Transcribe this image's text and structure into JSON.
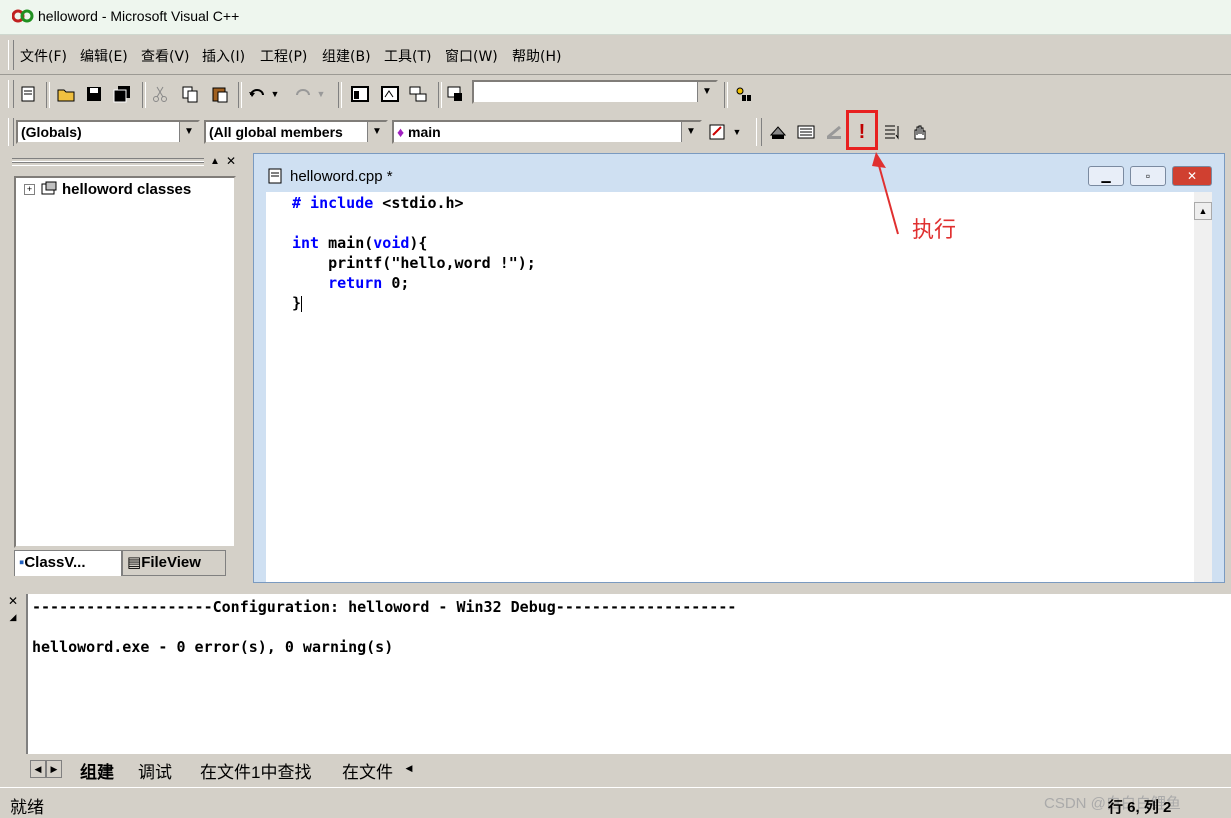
{
  "window": {
    "title": "helloword - Microsoft Visual C++"
  },
  "menubar": {
    "items": [
      "文件(F)",
      "编辑(E)",
      "查看(V)",
      "插入(I)",
      "工程(P)",
      "组建(B)",
      "工具(T)",
      "窗口(W)",
      "帮助(H)"
    ]
  },
  "toolbar2": {
    "globals": "(Globals)",
    "members": "(All global members",
    "function": "main",
    "function_marker": "♦"
  },
  "workspace": {
    "root": "helloword classes",
    "tabs": [
      "ClassV...",
      "FileView"
    ]
  },
  "editor": {
    "filename": "helloword.cpp *",
    "lines": [
      {
        "kw": "# include",
        "rest": " <stdio.h>"
      },
      {
        "kw": "",
        "rest": ""
      },
      {
        "kw": "int",
        "rest": " main(",
        "kw2": "void",
        "rest2": "){"
      },
      {
        "kw": "",
        "rest": "    printf(\"hello,word !\");"
      },
      {
        "kw": "    return",
        "rest": " 0;"
      },
      {
        "kw": "",
        "rest": "}"
      }
    ]
  },
  "output": {
    "line1": "--------------------Configuration: helloword - Win32 Debug--------------------",
    "line2": "helloword.exe - 0 error(s), 0 warning(s)",
    "tabs": [
      "组建",
      "调试",
      "在文件1中查找",
      "在文件"
    ]
  },
  "annotation": {
    "label": "执行",
    "color": "#e03030"
  },
  "statusbar": {
    "text": "就绪",
    "position": "行 6, 列 2",
    "watermark": "CSDN @白白白鲤鱼"
  }
}
